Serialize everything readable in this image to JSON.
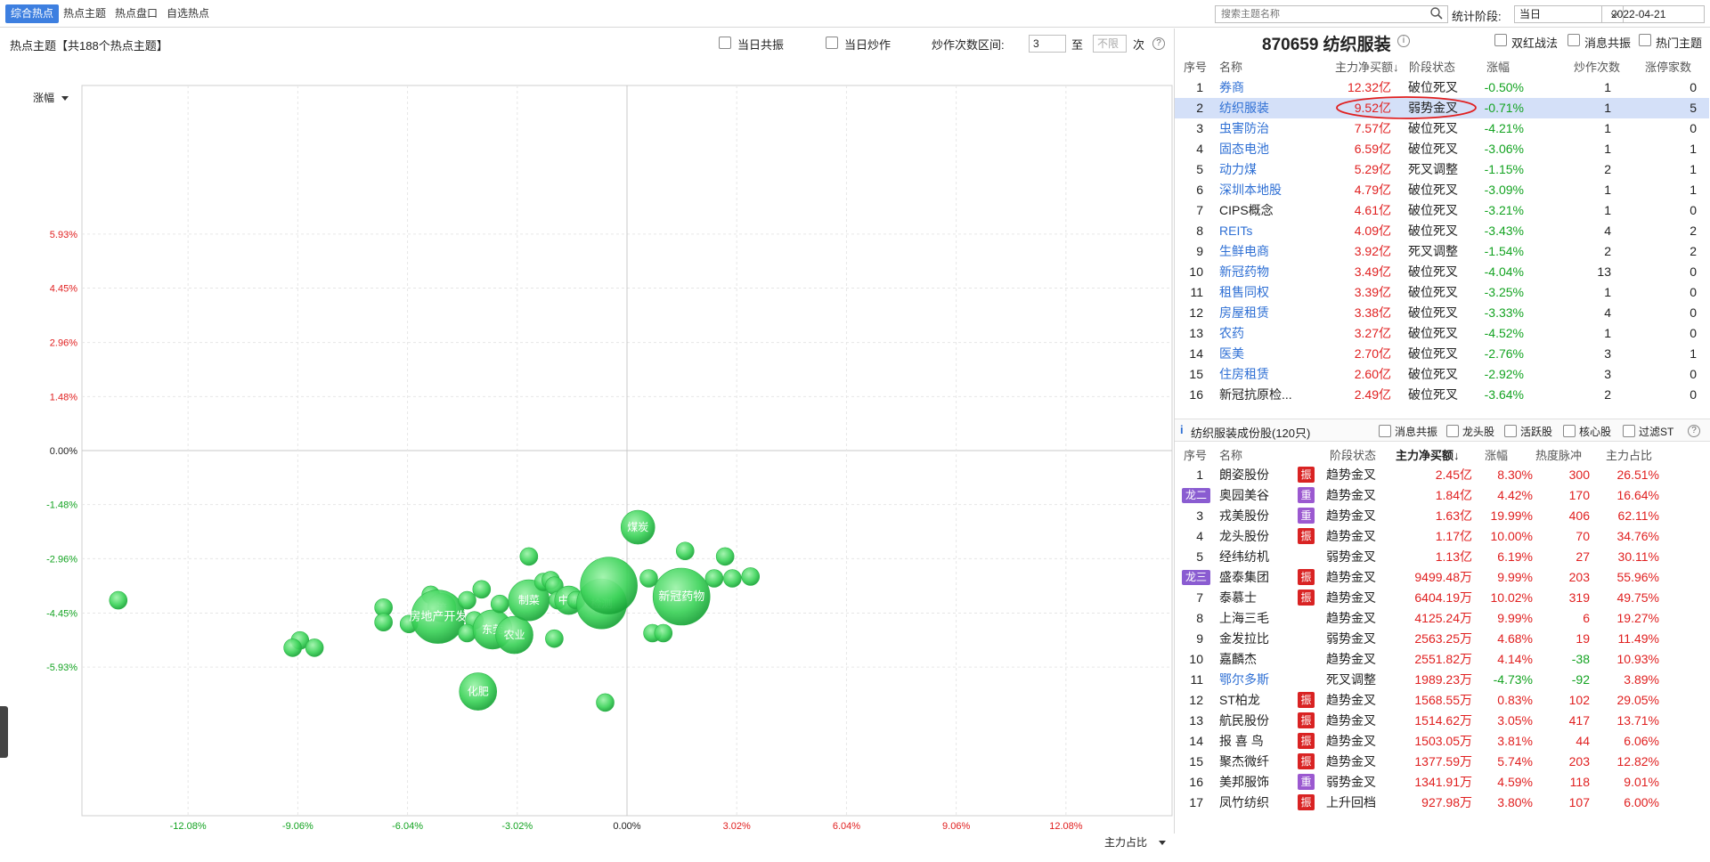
{
  "topbar": {
    "tabs": [
      "综合热点",
      "热点主题",
      "热点盘口",
      "自选热点"
    ],
    "search_placeholder": "搜索主题名称",
    "stat_label": "统计阶段:",
    "stat_value": "当日",
    "date": "2022-04-21"
  },
  "left": {
    "title": "热点主题【共188个热点主题】",
    "cb_resonance": "当日共振",
    "cb_hype": "当日炒作",
    "range_label": "炒作次数区间:",
    "range_from": "3",
    "range_to_label": "至",
    "range_to": "不限",
    "range_unit": "次",
    "help": "?"
  },
  "chart_data": {
    "type": "scatter",
    "ylabel": "涨幅",
    "xlabel": "主力占比",
    "ylim": [
      -10.0,
      10.0
    ],
    "xlim": [
      -15.0,
      15.0
    ],
    "yticks": [
      "5.93%",
      "4.45%",
      "2.96%",
      "1.48%",
      "0.00%",
      "-1.48%",
      "-2.96%",
      "-4.45%",
      "-5.93%"
    ],
    "ytick_vals": [
      5.93,
      4.45,
      2.96,
      1.48,
      0.0,
      -1.48,
      -2.96,
      -4.45,
      -5.93
    ],
    "xticks": [
      "-12.08%",
      "-9.06%",
      "-6.04%",
      "-3.02%",
      "0.00%",
      "3.02%",
      "6.04%",
      "9.06%",
      "12.08%"
    ],
    "xtick_vals": [
      -12.08,
      -9.06,
      -6.04,
      -3.02,
      0.0,
      3.02,
      6.04,
      9.06,
      12.08
    ],
    "points": [
      {
        "x": -14.0,
        "y": -4.1,
        "r": 1,
        "label": ""
      },
      {
        "x": -9.0,
        "y": -5.2,
        "r": 1,
        "label": ""
      },
      {
        "x": -8.6,
        "y": -5.4,
        "r": 1,
        "label": ""
      },
      {
        "x": -9.2,
        "y": -5.4,
        "r": 1,
        "label": ""
      },
      {
        "x": -6.7,
        "y": -4.3,
        "r": 1,
        "label": ""
      },
      {
        "x": -6.7,
        "y": -4.7,
        "r": 1,
        "label": ""
      },
      {
        "x": -6.0,
        "y": -4.75,
        "r": 1,
        "label": ""
      },
      {
        "x": -5.4,
        "y": -3.95,
        "r": 1,
        "label": ""
      },
      {
        "x": -5.1,
        "y": -4.3,
        "r": 1.6,
        "label": "流"
      },
      {
        "x": -5.2,
        "y": -4.55,
        "r": 3,
        "label": "房地产开发"
      },
      {
        "x": -4.4,
        "y": -4.1,
        "r": 1,
        "label": ""
      },
      {
        "x": -4.0,
        "y": -3.8,
        "r": 1,
        "label": ""
      },
      {
        "x": -4.2,
        "y": -4.65,
        "r": 1,
        "label": ""
      },
      {
        "x": -4.4,
        "y": -5.0,
        "r": 1,
        "label": ""
      },
      {
        "x": -3.7,
        "y": -4.9,
        "r": 2.2,
        "label": "东莞"
      },
      {
        "x": -3.5,
        "y": -4.2,
        "r": 1,
        "label": ""
      },
      {
        "x": -3.1,
        "y": -5.05,
        "r": 2.1,
        "label": "农业"
      },
      {
        "x": -2.7,
        "y": -4.1,
        "r": 2.3,
        "label": "制菜"
      },
      {
        "x": -2.7,
        "y": -2.9,
        "r": 1,
        "label": ""
      },
      {
        "x": -2.3,
        "y": -3.6,
        "r": 1,
        "label": ""
      },
      {
        "x": -2.1,
        "y": -3.55,
        "r": 1,
        "label": ""
      },
      {
        "x": -2.0,
        "y": -3.7,
        "r": 1,
        "label": ""
      },
      {
        "x": -2.0,
        "y": -5.15,
        "r": 1,
        "label": ""
      },
      {
        "x": -1.9,
        "y": -4.1,
        "r": 1,
        "label": ""
      },
      {
        "x": -1.6,
        "y": -4.1,
        "r": 1.6,
        "label": "中成"
      },
      {
        "x": -1.4,
        "y": -4.1,
        "r": 1,
        "label": ""
      },
      {
        "x": -0.7,
        "y": -4.2,
        "r": 2.8,
        "label": "检测"
      },
      {
        "x": -0.5,
        "y": -3.7,
        "r": 3.2,
        "label": ""
      },
      {
        "x": -0.6,
        "y": -6.9,
        "r": 1,
        "label": ""
      },
      {
        "x": 0.6,
        "y": -3.5,
        "r": 1,
        "label": ""
      },
      {
        "x": 0.3,
        "y": -2.1,
        "r": 1.9,
        "label": "煤炭"
      },
      {
        "x": 1.6,
        "y": -2.75,
        "r": 1,
        "label": ""
      },
      {
        "x": 1.5,
        "y": -4.0,
        "r": 3.2,
        "label": "新冠药物"
      },
      {
        "x": 2.7,
        "y": -2.9,
        "r": 1,
        "label": ""
      },
      {
        "x": 2.4,
        "y": -3.5,
        "r": 1,
        "label": ""
      },
      {
        "x": 2.9,
        "y": -3.5,
        "r": 1,
        "label": ""
      },
      {
        "x": 3.4,
        "y": -3.45,
        "r": 1,
        "label": ""
      },
      {
        "x": 0.7,
        "y": -5.0,
        "r": 1,
        "label": ""
      },
      {
        "x": 1.0,
        "y": -5.0,
        "r": 1,
        "label": ""
      },
      {
        "x": -4.1,
        "y": -6.6,
        "r": 2.1,
        "label": "化肥"
      }
    ]
  },
  "right": {
    "title": "870659 纺织服装",
    "cb_double": "双红战法",
    "cb_news": "消息共振",
    "cb_hot": "热门主题",
    "headers": [
      "序号",
      "名称",
      "主力净买额↓",
      "阶段状态",
      "涨幅",
      "炒作次数",
      "涨停家数"
    ],
    "rows": [
      {
        "no": "1",
        "name": "券商",
        "amt": "12.32亿",
        "stage": "破位死叉",
        "chg": "-0.50%",
        "times": "1",
        "limit": "0",
        "nc": "blue"
      },
      {
        "no": "2",
        "name": "纺织服装",
        "amt": "9.52亿",
        "stage": "弱势金叉",
        "chg": "-0.71%",
        "times": "1",
        "limit": "5",
        "nc": "blue"
      },
      {
        "no": "3",
        "name": "虫害防治",
        "amt": "7.57亿",
        "stage": "破位死叉",
        "chg": "-4.21%",
        "times": "1",
        "limit": "0",
        "nc": "blue"
      },
      {
        "no": "4",
        "name": "固态电池",
        "amt": "6.59亿",
        "stage": "破位死叉",
        "chg": "-3.06%",
        "times": "1",
        "limit": "1",
        "nc": "blue"
      },
      {
        "no": "5",
        "name": "动力煤",
        "amt": "5.29亿",
        "stage": "死叉调整",
        "chg": "-1.15%",
        "times": "2",
        "limit": "1",
        "nc": "blue"
      },
      {
        "no": "6",
        "name": "深圳本地股",
        "amt": "4.79亿",
        "stage": "破位死叉",
        "chg": "-3.09%",
        "times": "1",
        "limit": "1",
        "nc": "blue"
      },
      {
        "no": "7",
        "name": "CIPS概念",
        "amt": "4.61亿",
        "stage": "破位死叉",
        "chg": "-3.21%",
        "times": "1",
        "limit": "0",
        "nc": "black"
      },
      {
        "no": "8",
        "name": "REITs",
        "amt": "4.09亿",
        "stage": "破位死叉",
        "chg": "-3.43%",
        "times": "4",
        "limit": "2",
        "nc": "blue"
      },
      {
        "no": "9",
        "name": "生鲜电商",
        "amt": "3.92亿",
        "stage": "死叉调整",
        "chg": "-1.54%",
        "times": "2",
        "limit": "2",
        "nc": "blue"
      },
      {
        "no": "10",
        "name": "新冠药物",
        "amt": "3.49亿",
        "stage": "破位死叉",
        "chg": "-4.04%",
        "times": "13",
        "limit": "0",
        "nc": "blue"
      },
      {
        "no": "11",
        "name": "租售同权",
        "amt": "3.39亿",
        "stage": "破位死叉",
        "chg": "-3.25%",
        "times": "1",
        "limit": "0",
        "nc": "blue"
      },
      {
        "no": "12",
        "name": "房屋租赁",
        "amt": "3.38亿",
        "stage": "破位死叉",
        "chg": "-3.33%",
        "times": "4",
        "limit": "0",
        "nc": "blue"
      },
      {
        "no": "13",
        "name": "农药",
        "amt": "3.27亿",
        "stage": "破位死叉",
        "chg": "-4.52%",
        "times": "1",
        "limit": "0",
        "nc": "blue"
      },
      {
        "no": "14",
        "name": "医美",
        "amt": "2.70亿",
        "stage": "破位死叉",
        "chg": "-2.76%",
        "times": "3",
        "limit": "1",
        "nc": "blue"
      },
      {
        "no": "15",
        "name": "住房租赁",
        "amt": "2.60亿",
        "stage": "破位死叉",
        "chg": "-2.92%",
        "times": "3",
        "limit": "0",
        "nc": "blue"
      },
      {
        "no": "16",
        "name": "新冠抗原检...",
        "amt": "2.49亿",
        "stage": "破位死叉",
        "chg": "-3.64%",
        "times": "2",
        "limit": "0",
        "nc": "black"
      }
    ],
    "sec2": {
      "title": "纺织服装成份股(120只)",
      "cbs": [
        "消息共振",
        "龙头股",
        "活跃股",
        "核心股",
        "过滤ST"
      ],
      "help": "?"
    },
    "headers2": [
      "序号",
      "名称",
      "阶段状态",
      "主力净买额↓",
      "涨幅",
      "热度脉冲",
      "主力占比"
    ],
    "stocks": [
      {
        "no": "1",
        "badge": "",
        "name": "朗姿股份",
        "tag": "振",
        "tt": "z",
        "stage": "趋势金叉",
        "amt": "2.45亿",
        "chg": "8.30%",
        "heat": "300",
        "ratio": "26.51%",
        "hc": "red",
        "cc": "red",
        "nc": "black"
      },
      {
        "no": "",
        "badge": "龙二",
        "name": "奥园美谷",
        "tag": "重",
        "tt": "zh",
        "stage": "趋势金叉",
        "amt": "1.84亿",
        "chg": "4.42%",
        "heat": "170",
        "ratio": "16.64%",
        "hc": "red",
        "cc": "red",
        "nc": "black"
      },
      {
        "no": "3",
        "badge": "",
        "name": "戎美股份",
        "tag": "重",
        "tt": "zh",
        "stage": "趋势金叉",
        "amt": "1.63亿",
        "chg": "19.99%",
        "heat": "406",
        "ratio": "62.11%",
        "hc": "red",
        "cc": "red",
        "nc": "black"
      },
      {
        "no": "4",
        "badge": "",
        "name": "龙头股份",
        "tag": "振",
        "tt": "z",
        "stage": "趋势金叉",
        "amt": "1.17亿",
        "chg": "10.00%",
        "heat": "70",
        "ratio": "34.76%",
        "hc": "red",
        "cc": "red",
        "nc": "black"
      },
      {
        "no": "5",
        "badge": "",
        "name": "经纬纺机",
        "tag": "",
        "tt": "",
        "stage": "弱势金叉",
        "amt": "1.13亿",
        "chg": "6.19%",
        "heat": "27",
        "ratio": "30.11%",
        "hc": "red",
        "cc": "red",
        "nc": "black"
      },
      {
        "no": "",
        "badge": "龙三",
        "name": "盛泰集团",
        "tag": "振",
        "tt": "z",
        "stage": "趋势金叉",
        "amt": "9499.48万",
        "chg": "9.99%",
        "heat": "203",
        "ratio": "55.96%",
        "hc": "red",
        "cc": "red",
        "nc": "black"
      },
      {
        "no": "7",
        "badge": "",
        "name": "泰慕士",
        "tag": "振",
        "tt": "z",
        "stage": "趋势金叉",
        "amt": "6404.19万",
        "chg": "10.02%",
        "heat": "319",
        "ratio": "49.75%",
        "hc": "red",
        "cc": "red",
        "nc": "black"
      },
      {
        "no": "8",
        "badge": "",
        "name": "上海三毛",
        "tag": "",
        "tt": "",
        "stage": "趋势金叉",
        "amt": "4125.24万",
        "chg": "9.99%",
        "heat": "6",
        "ratio": "19.27%",
        "hc": "red",
        "cc": "red",
        "nc": "black"
      },
      {
        "no": "9",
        "badge": "",
        "name": "金发拉比",
        "tag": "",
        "tt": "",
        "stage": "弱势金叉",
        "amt": "2563.25万",
        "chg": "4.68%",
        "heat": "19",
        "ratio": "11.49%",
        "hc": "red",
        "cc": "red",
        "nc": "black"
      },
      {
        "no": "10",
        "badge": "",
        "name": "嘉麟杰",
        "tag": "",
        "tt": "",
        "stage": "趋势金叉",
        "amt": "2551.82万",
        "chg": "4.14%",
        "heat": "-38",
        "ratio": "10.93%",
        "hc": "green",
        "cc": "red",
        "nc": "black"
      },
      {
        "no": "11",
        "badge": "",
        "name": "鄂尔多斯",
        "tag": "",
        "tt": "",
        "stage": "死叉调整",
        "amt": "1989.23万",
        "chg": "-4.73%",
        "heat": "-92",
        "ratio": "3.89%",
        "hc": "green",
        "cc": "green",
        "nc": "blue"
      },
      {
        "no": "12",
        "badge": "",
        "name": "ST柏龙",
        "tag": "振",
        "tt": "z",
        "stage": "趋势金叉",
        "amt": "1568.55万",
        "chg": "0.83%",
        "heat": "102",
        "ratio": "29.05%",
        "hc": "red",
        "cc": "red",
        "nc": "black"
      },
      {
        "no": "13",
        "badge": "",
        "name": "航民股份",
        "tag": "振",
        "tt": "z",
        "stage": "趋势金叉",
        "amt": "1514.62万",
        "chg": "3.05%",
        "heat": "417",
        "ratio": "13.71%",
        "hc": "red",
        "cc": "red",
        "nc": "black"
      },
      {
        "no": "14",
        "badge": "",
        "name": "报 喜 鸟",
        "tag": "振",
        "tt": "z",
        "stage": "趋势金叉",
        "amt": "1503.05万",
        "chg": "3.81%",
        "heat": "44",
        "ratio": "6.06%",
        "hc": "red",
        "cc": "red",
        "nc": "black"
      },
      {
        "no": "15",
        "badge": "",
        "name": "聚杰微纤",
        "tag": "振",
        "tt": "z",
        "stage": "趋势金叉",
        "amt": "1377.59万",
        "chg": "5.74%",
        "heat": "203",
        "ratio": "12.82%",
        "hc": "red",
        "cc": "red",
        "nc": "black"
      },
      {
        "no": "16",
        "badge": "",
        "name": "美邦服饰",
        "tag": "重",
        "tt": "zh",
        "stage": "弱势金叉",
        "amt": "1341.91万",
        "chg": "4.59%",
        "heat": "118",
        "ratio": "9.01%",
        "hc": "red",
        "cc": "red",
        "nc": "black"
      },
      {
        "no": "17",
        "badge": "",
        "name": "凤竹纺织",
        "tag": "振",
        "tt": "z",
        "stage": "上升回档",
        "amt": "927.98万",
        "chg": "3.80%",
        "heat": "107",
        "ratio": "6.00%",
        "hc": "red",
        "cc": "red",
        "nc": "black"
      }
    ]
  }
}
